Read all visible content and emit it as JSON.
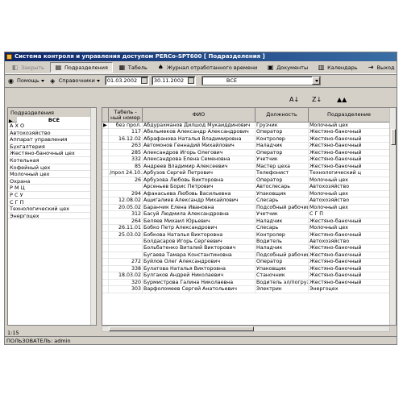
{
  "window": {
    "title": "Система контроля и управления доступом PERCo-SPT600 [ Подразделения ]"
  },
  "toolbar1": [
    {
      "label": "Закрыть",
      "icon": "◧",
      "disabled": true,
      "active": false,
      "name": "close-button",
      "iname": "close-icon"
    },
    {
      "label": "Подразделения",
      "icon": "▤",
      "disabled": false,
      "active": true,
      "name": "departments-button",
      "iname": "departments-icon"
    },
    {
      "label": "Табель",
      "icon": "▦",
      "disabled": false,
      "active": false,
      "name": "timesheet-button",
      "iname": "timesheet-icon"
    },
    {
      "label": "Журнал отработанного времени",
      "icon": "♠",
      "disabled": false,
      "active": false,
      "name": "worked-time-log-button",
      "iname": "log-icon"
    },
    {
      "label": "Документы",
      "icon": "▣",
      "disabled": false,
      "active": false,
      "name": "documents-button",
      "iname": "documents-icon"
    },
    {
      "label": "Календарь",
      "icon": "▥",
      "disabled": false,
      "active": false,
      "name": "calendar-button",
      "iname": "calendar-icon"
    },
    {
      "label": "Выход",
      "icon": "⇥",
      "disabled": false,
      "active": false,
      "name": "exit-button",
      "iname": "exit-icon"
    }
  ],
  "toolbar2": {
    "help": "Помощь",
    "references": "Справочники",
    "date_from": "01.03.2002",
    "date_to": "30.11.2002",
    "filter": "ВСЕ"
  },
  "sort_icons": [
    "A↓",
    "Z↓",
    "▲▲"
  ],
  "departments": {
    "header": "Подразделения",
    "selected": "ВСЕ",
    "items": [
      "А Х О",
      "Автохозяйство",
      "Аппарат управления",
      "Бухгалтерия",
      "Жестяно-баночный цех",
      "Котельная",
      "Кофейный цех",
      "Молочный цех",
      "Охрана",
      "Р  М  Ц",
      "Р  С  У",
      "С  Г  П",
      "Технологический цех",
      "Энергоцех"
    ]
  },
  "grid": {
    "headers": [
      "Табель - ный номер",
      "ФИО",
      "Должность",
      "Подразделение"
    ],
    "rows": [
      [
        "без прол.",
        "Абдурахманов Дилшод Мукаиддинович",
        "Грузчик",
        "Молочный цех"
      ],
      [
        "117",
        "Абельмеков Александр Александрович",
        "Оператор",
        "Жестяно-баночный"
      ],
      [
        "16.12.02",
        "Абрафанова Наталья Владимировна",
        "Контролер",
        "Жестяно-баночный"
      ],
      [
        "263",
        "Автомонов Геннадий Михайлович",
        "Наладчик",
        "Жестяно-баночный"
      ],
      [
        "285",
        "Александров Игорь Олегович",
        "Оператор",
        "Жестяно-баночный"
      ],
      [
        "332",
        "Александрова Елена Семеновна",
        "Учетчик",
        "Жестяно-баночный"
      ],
      [
        "85",
        "Андреев Владимир Алексеевич",
        "Мастер цеха",
        "Жестяно-баночный"
      ],
      [
        "/прол 24.10.0",
        "Арбузов Сергей Петрович",
        "Телефонист",
        "Технологический ц"
      ],
      [
        "26",
        "Арбузова Любовь Викторовна",
        "Оператор",
        "Молочный цех"
      ],
      [
        "",
        "Арсеньев Борис Петрович",
        "Автослесарь",
        "Автохозяйство"
      ],
      [
        "294",
        "Афанасьева Любовь Васильевна",
        "Упаковщик",
        "Молочный цех"
      ],
      [
        "12.08.02",
        "Ащигалиев Александр Михайлович",
        "Слесарь",
        "Автохозяйство"
      ],
      [
        "20.05.02",
        "Баранчик Елена Ивановна",
        "Подсобный рабочий",
        "Молочный цех"
      ],
      [
        "312",
        "Басуй Людмила Александровна",
        "Учетчик",
        "С Г П"
      ],
      [
        "264",
        "Беляев Михаил Юрьевич",
        "Наладчик",
        "Жестяно-баночный"
      ],
      [
        "26.11.01",
        "Бобко Петр Александрович",
        "Слесарь",
        "Молочный цех"
      ],
      [
        "25.03.02",
        "Бобкова Наталья Викторовна",
        "Контролер",
        "Жестяно-баночный"
      ],
      [
        "",
        "Болдасаров Игорь Сергеевич",
        "Водитель",
        "Автохозяйство"
      ],
      [
        "",
        "Больбатенко Виталий Викторович",
        "Наладчик",
        "Жестяно-баночный"
      ],
      [
        "",
        "Бугаева Тамара Константиновна",
        "Подсобный рабочий",
        "Жестяно-баночный"
      ],
      [
        "272",
        "Буйлов Олег Александрович",
        "Оператор",
        "Жестяно-баночный"
      ],
      [
        "338",
        "Булатова Наталья Викторовна",
        "Упаковщик",
        "Жестяно-баночный"
      ],
      [
        "18.03.02",
        "Булгаков Андрей Николаевич",
        "Станочник",
        "Жестяно-баночный"
      ],
      [
        "320",
        "Бурмистрова Галина Николаевна",
        "Водитель эл/погрузчика",
        "Жестяно-баночный"
      ],
      [
        "303",
        "Варфоломеев Сергей Анатольевич",
        "Электрик",
        "Энергоцех"
      ]
    ]
  },
  "count_text": "1:15",
  "status_text": "ПОЛЬЗОВАТЕЛЬ: admin"
}
